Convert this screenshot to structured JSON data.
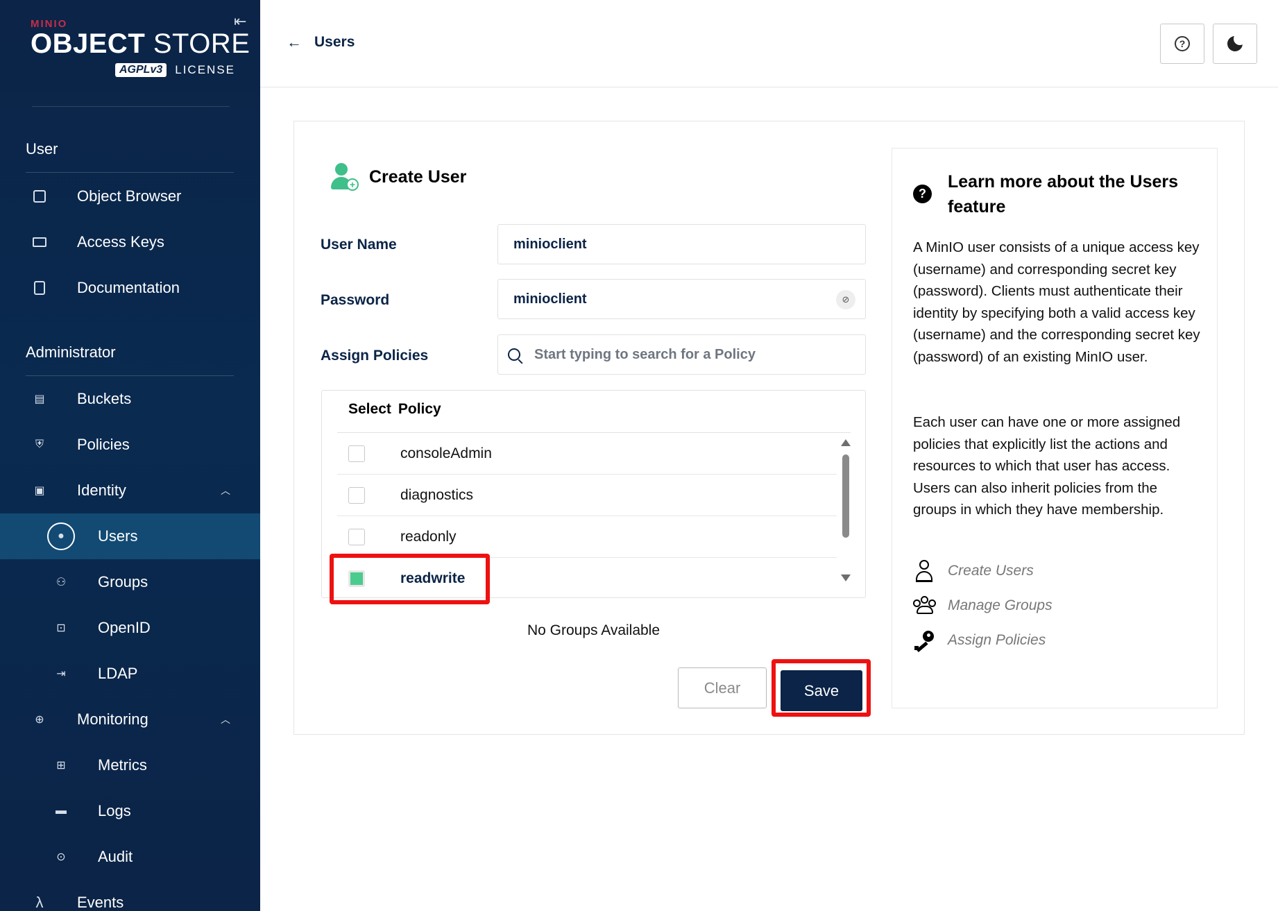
{
  "brand": {
    "minio": "MINIO",
    "object": "OBJECT",
    "store": "STORE",
    "agpl": "AGPLv3",
    "license": "LICENSE"
  },
  "sidebar": {
    "user_section": "User",
    "user_items": [
      {
        "label": "Object Browser",
        "icon": "object-browser-icon"
      },
      {
        "label": "Access Keys",
        "icon": "access-keys-icon"
      },
      {
        "label": "Documentation",
        "icon": "documentation-icon"
      }
    ],
    "admin_section": "Administrator",
    "admin_items": [
      {
        "label": "Buckets",
        "icon": "bucket-icon"
      },
      {
        "label": "Policies",
        "icon": "shield-icon"
      },
      {
        "label": "Identity",
        "icon": "id-card-icon",
        "expanded": true
      },
      {
        "label": "Users",
        "icon": "user-circle-icon",
        "active": true
      },
      {
        "label": "Groups",
        "icon": "groups-icon"
      },
      {
        "label": "OpenID",
        "icon": "lock-icon"
      },
      {
        "label": "LDAP",
        "icon": "login-icon"
      },
      {
        "label": "Monitoring",
        "icon": "monitor-search-icon",
        "expanded": true
      },
      {
        "label": "Metrics",
        "icon": "grid-icon"
      },
      {
        "label": "Logs",
        "icon": "logs-icon"
      },
      {
        "label": "Audit",
        "icon": "audit-icon"
      },
      {
        "label": "Events",
        "icon": "lambda-icon"
      }
    ]
  },
  "header": {
    "back_label": "Users"
  },
  "form": {
    "title": "Create User",
    "username_label": "User Name",
    "username_value": "minioclient",
    "password_label": "Password",
    "password_value": "minioclient",
    "policies_label": "Assign Policies",
    "policies_placeholder": "Start typing to search for a Policy",
    "table_head_select": "Select",
    "table_head_policy": "Policy",
    "policies": [
      {
        "name": "consoleAdmin",
        "checked": false
      },
      {
        "name": "diagnostics",
        "checked": false
      },
      {
        "name": "readonly",
        "checked": false
      },
      {
        "name": "readwrite",
        "checked": true
      }
    ],
    "no_groups": "No Groups Available",
    "clear_label": "Clear",
    "save_label": "Save"
  },
  "help": {
    "title": "Learn more about the Users feature",
    "p1": "A MinIO user consists of a unique access key (username) and corresponding secret key (password). Clients must authenticate their identity by specifying both a valid access key (username) and the corresponding secret key (password) of an existing MinIO user.",
    "p2": "Each user can have one or more assigned policies that explicitly list the actions and resources to which that user has access. Users can also inherit policies from the groups in which they have membership.",
    "links": [
      "Create Users",
      "Manage Groups",
      "Assign Policies"
    ]
  },
  "colors": {
    "sidebar_bg": "#0b2447",
    "active_item": "#124a73",
    "accent_green": "#4ccb8f",
    "highlight_red": "#ee1111",
    "save_bg": "#0b2447"
  }
}
